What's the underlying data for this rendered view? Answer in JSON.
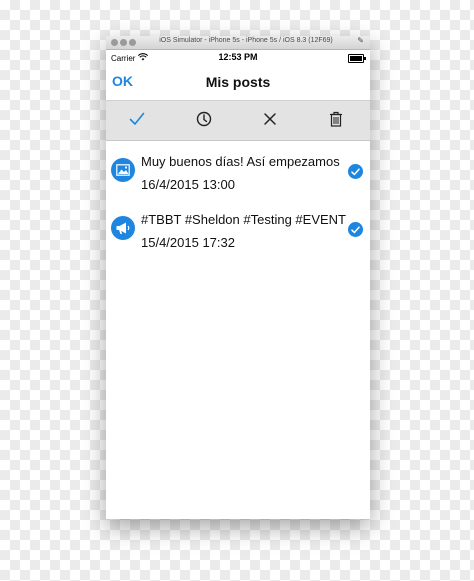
{
  "simulator": {
    "title": "iOS Simulator - iPhone 5s - iPhone 5s / iOS 8.3 (12F69)"
  },
  "statusbar": {
    "carrier": "Carrier",
    "time": "12:53 PM"
  },
  "navbar": {
    "back_label": "OK",
    "title": "Mis posts"
  },
  "toolbar": {
    "buttons": [
      {
        "icon": "checkmark-icon"
      },
      {
        "icon": "clock-icon"
      },
      {
        "icon": "close-icon"
      },
      {
        "icon": "trash-icon"
      }
    ]
  },
  "posts": [
    {
      "icon": "image-icon",
      "title": "Muy buenos días! Así empezamos",
      "date": "16/4/2015 13:00",
      "selected": true
    },
    {
      "icon": "megaphone-icon",
      "title": "#TBBT #Sheldon #Testing #EVENT",
      "date": "15/4/2015 17:32",
      "selected": true
    }
  ],
  "colors": {
    "accent": "#1e86df",
    "toolbar_bg": "#e3e3e3",
    "text": "#111111"
  }
}
